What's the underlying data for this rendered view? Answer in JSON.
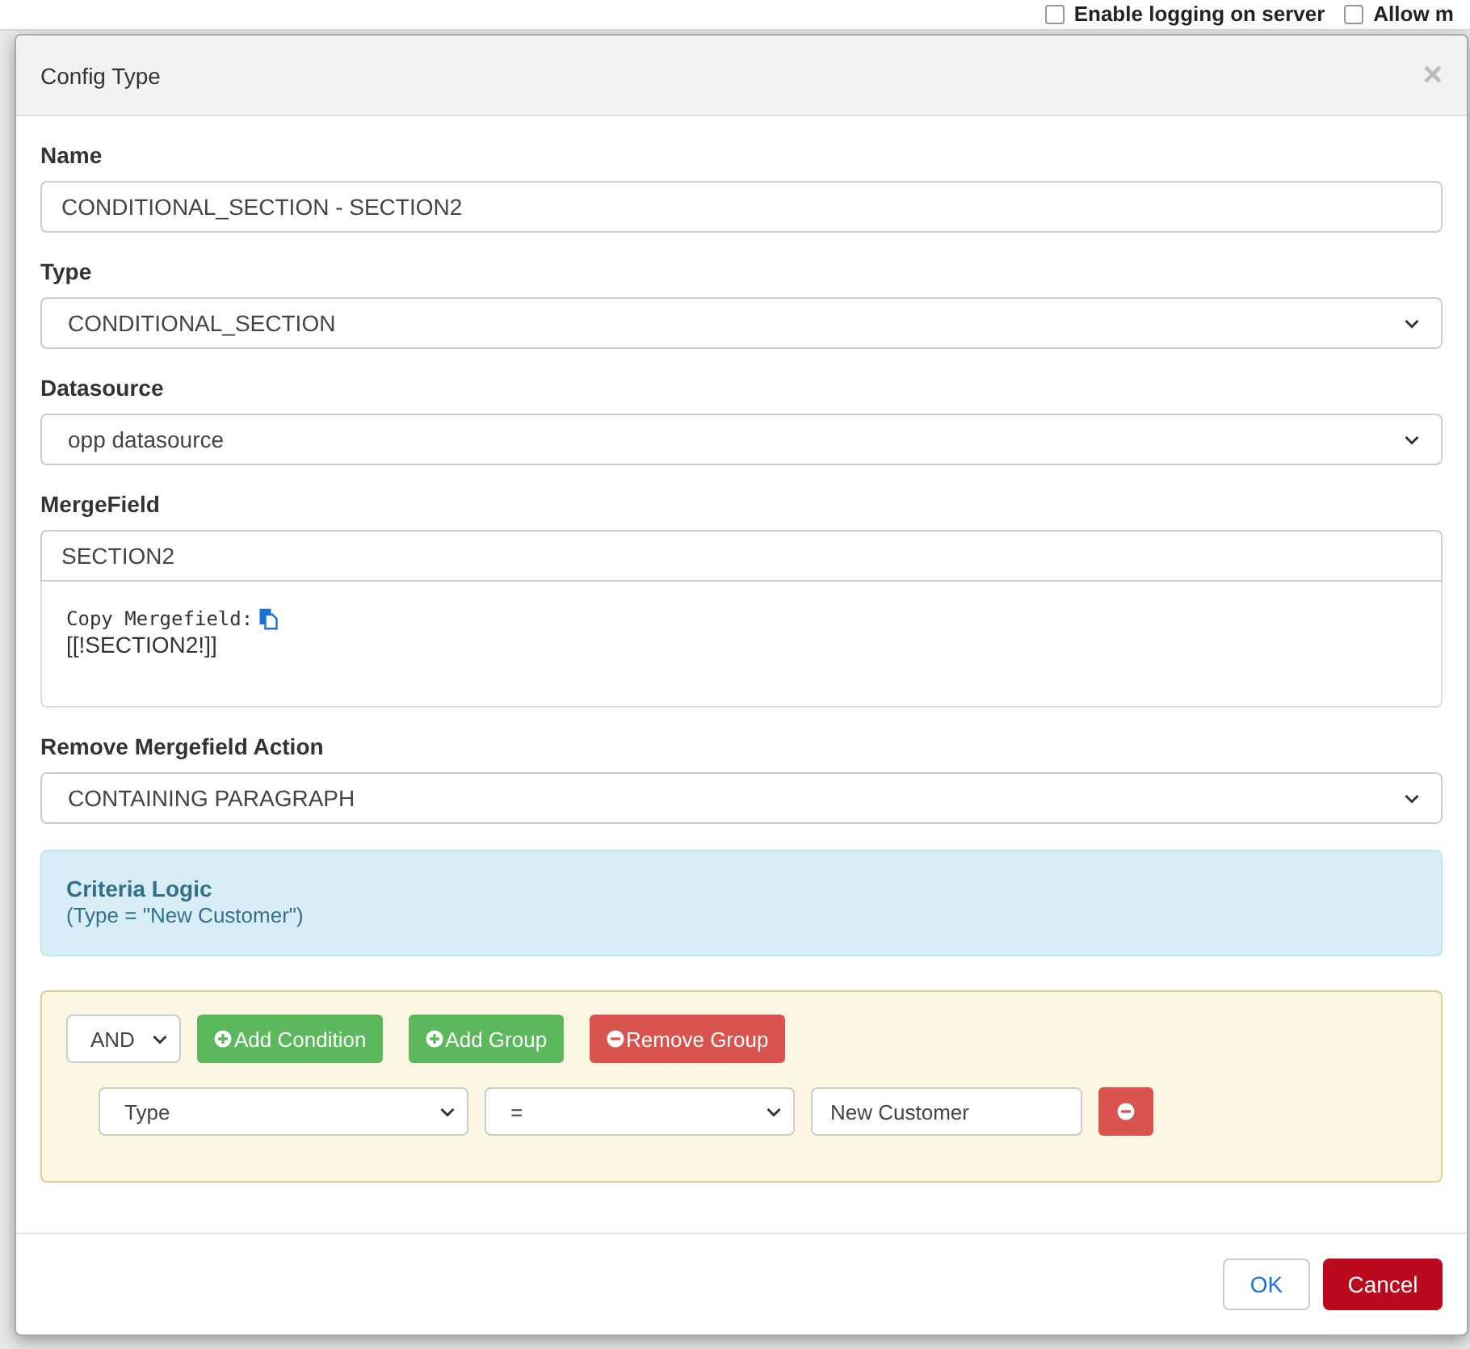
{
  "background": {
    "options": [
      {
        "label": "Enable logging on server",
        "checked": false
      },
      {
        "label": "Allow m",
        "checked": false
      }
    ]
  },
  "dialog": {
    "title": "Config Type",
    "close": "×",
    "fields": [
      {
        "kind": "text",
        "label": "Name",
        "value": "CONDITIONAL_SECTION - SECTION2"
      },
      {
        "kind": "select",
        "label": "Type",
        "value": "CONDITIONAL_SECTION"
      },
      {
        "kind": "select",
        "label": "Datasource",
        "value": "opp datasource"
      },
      {
        "kind": "merge",
        "label": "MergeField",
        "value": "SECTION2",
        "copy_label": "Copy Mergefield:",
        "token": "[[!SECTION2!]]"
      },
      {
        "kind": "select",
        "label": "Remove Mergefield Action",
        "value": "CONTAINING PARAGRAPH"
      }
    ],
    "criteria": {
      "title": "Criteria Logic",
      "expression": "(Type = \"New Customer\")"
    },
    "builder": {
      "operator": "AND",
      "buttons": [
        {
          "label": "Add Condition",
          "kind": "add"
        },
        {
          "label": "Add Group",
          "kind": "add"
        },
        {
          "label": "Remove Group",
          "kind": "remove"
        }
      ],
      "rules": [
        {
          "field": "Type",
          "comparison": "=",
          "value": "New Customer"
        }
      ]
    },
    "buttons": [
      {
        "label": "OK",
        "kind": "default"
      },
      {
        "label": "Cancel",
        "kind": "danger"
      }
    ]
  }
}
